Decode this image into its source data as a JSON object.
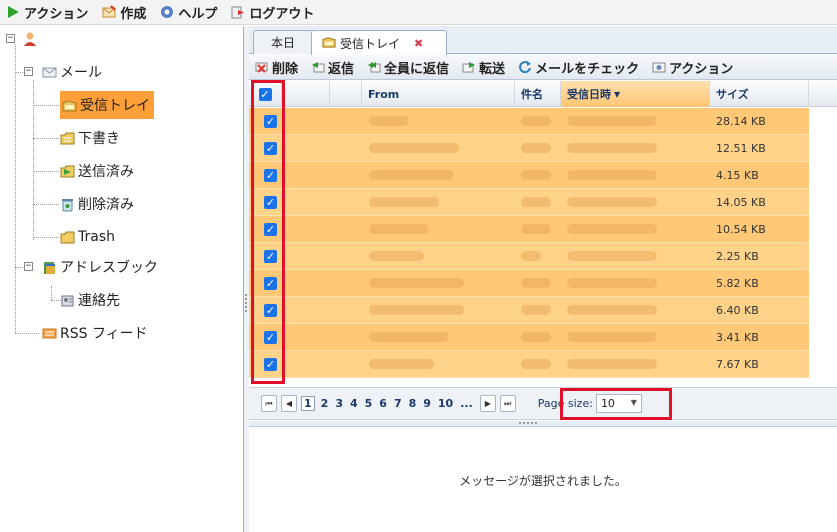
{
  "topbar": {
    "items": [
      {
        "label": "アクション",
        "icon": "play-icon"
      },
      {
        "label": "作成",
        "icon": "compose-icon"
      },
      {
        "label": "ヘルプ",
        "icon": "help-icon"
      },
      {
        "label": "ログアウト",
        "icon": "logout-icon"
      }
    ]
  },
  "tree": {
    "mail": "メール",
    "inbox": "受信トレイ",
    "drafts": "下書き",
    "sent": "送信済み",
    "deleted": "削除済み",
    "trash": "Trash",
    "addressbook": "アドレスブック",
    "contacts": "連絡先",
    "rss": "RSS フィード"
  },
  "tabs": [
    {
      "label": "本日"
    },
    {
      "label": "受信トレイ",
      "close": "✖"
    }
  ],
  "toolbar": {
    "delete": "削除",
    "reply": "返信",
    "reply_all": "全員に返信",
    "forward": "転送",
    "check_mail": "メールをチェック",
    "action": "アクション"
  },
  "grid": {
    "columns": {
      "from": "From",
      "subject": "件名",
      "received": "受信日時",
      "size": "サイズ"
    },
    "rows": [
      {
        "size": "28.14 KB"
      },
      {
        "size": "12.51 KB"
      },
      {
        "size": "4.15 KB"
      },
      {
        "size": "14.05 KB"
      },
      {
        "size": "10.54 KB"
      },
      {
        "size": "2.25 KB"
      },
      {
        "size": "5.82 KB"
      },
      {
        "size": "6.40 KB"
      },
      {
        "size": "3.41 KB"
      },
      {
        "size": "7.67 KB"
      }
    ]
  },
  "pager": {
    "pages": [
      "1",
      "2",
      "3",
      "4",
      "5",
      "6",
      "7",
      "8",
      "9",
      "10",
      "..."
    ],
    "page_size_label": "Page size:",
    "page_size_value": "10"
  },
  "preview": {
    "message": "メッセージが選択されました。"
  },
  "colors": {
    "row": "#ffc877",
    "selected_node": "#ff9f37",
    "highlight": "#e0102b",
    "checkbox": "#1a73e8"
  }
}
